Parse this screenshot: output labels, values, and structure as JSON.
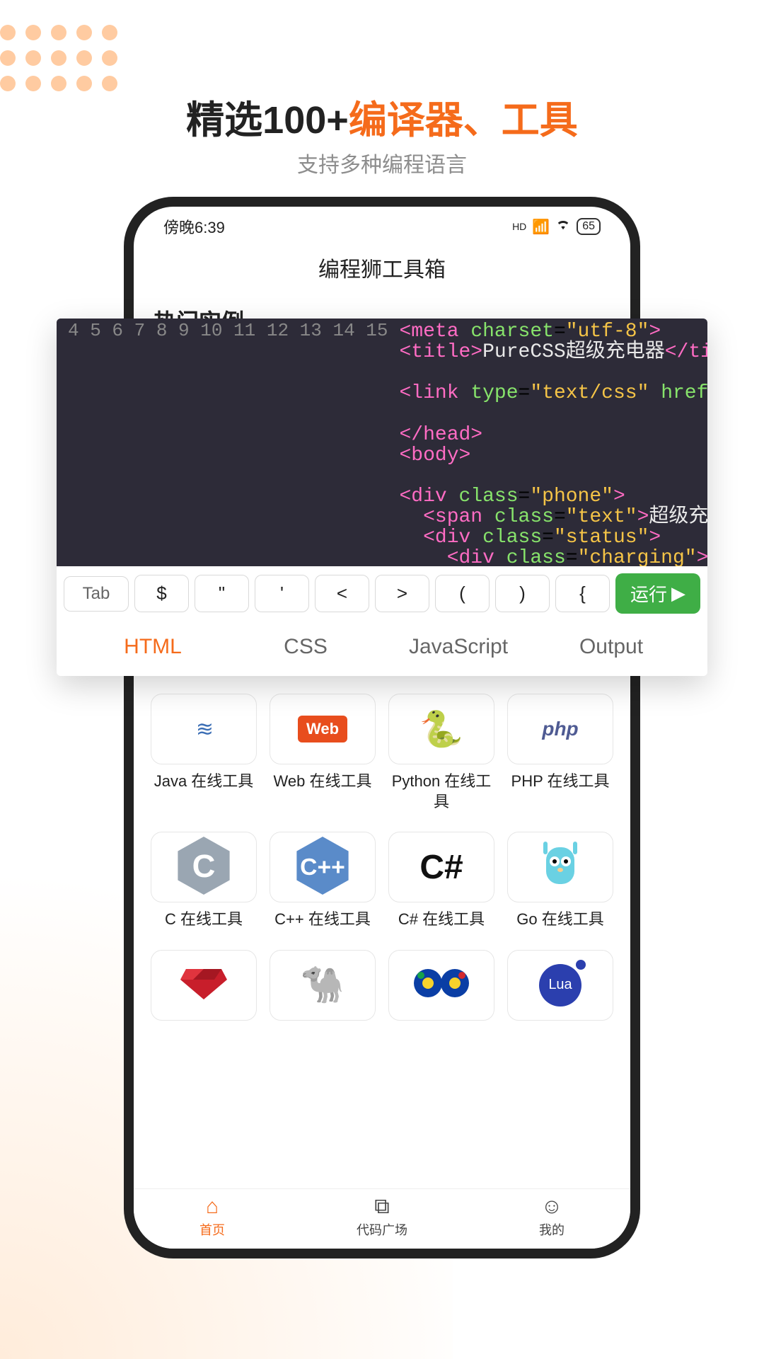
{
  "headline": {
    "pre": "精选100+",
    "accent": "编译器、工具"
  },
  "subhead": "支持多种编程语言",
  "phone": {
    "status_time": "傍晚6:39",
    "status_net": "HD",
    "battery": "65",
    "title": "编程狮工具箱",
    "section": "热门实例",
    "nav": {
      "home": "首页",
      "plaza": "代码广场",
      "me": "我的"
    },
    "tools_row1": [
      {
        "label": "Java 在线工具",
        "icon": "java"
      },
      {
        "label": "Web 在线工具",
        "icon": "web"
      },
      {
        "label": "Python 在线工具",
        "icon": "python"
      },
      {
        "label": "PHP 在线工具",
        "icon": "php"
      }
    ],
    "tools_row2": [
      {
        "label": "C 在线工具",
        "icon": "c"
      },
      {
        "label": "C++ 在线工具",
        "icon": "cpp"
      },
      {
        "label": "C# 在线工具",
        "icon": "csh"
      },
      {
        "label": "Go 在线工具",
        "icon": "go"
      }
    ],
    "tools_row3": [
      {
        "icon": "ruby"
      },
      {
        "icon": "perl"
      },
      {
        "icon": "raku"
      },
      {
        "icon": "lua"
      }
    ]
  },
  "editor": {
    "gutter": [
      "4",
      "5",
      "6",
      "7",
      "8",
      "9",
      "10",
      "11",
      "12",
      "13",
      "14",
      "15"
    ],
    "code_lines": [
      {
        "html": "<span class='tg'>&lt;meta</span> <span class='at'>charset</span>=<span class='st'>\"utf-8\"</span><span class='tg'>&gt;</span>"
      },
      {
        "html": "<span class='tg'>&lt;title&gt;</span><span class='tx'>PureCSS超级充电器</span><span class='tg'>&lt;/title&gt;</span>"
      },
      {
        "html": ""
      },
      {
        "html": "<span class='tg'>&lt;link</span> <span class='at'>type</span>=<span class='st'>\"text/css\"</span> <span class='at'>href</span>=<span class='st'>\"css/style.cs</span>"
      },
      {
        "html": ""
      },
      {
        "html": "<span class='tg'>&lt;/head&gt;</span>"
      },
      {
        "html": "<span class='tg'>&lt;body&gt;</span>"
      },
      {
        "html": ""
      },
      {
        "html": "<span class='tg'>&lt;div</span> <span class='at'>class</span>=<span class='st'>\"phone\"</span><span class='tg'>&gt;</span>"
      },
      {
        "html": "  <span class='tg'>&lt;span</span> <span class='at'>class</span>=<span class='st'>\"text\"</span><span class='tg'>&gt;</span><span class='tx'>超级充电</span><span class='tg'>&lt;/span&gt;</span>"
      },
      {
        "html": "  <span class='tg'>&lt;div</span> <span class='at'>class</span>=<span class='st'>\"status\"</span><span class='tg'>&gt;</span>"
      },
      {
        "html": "    <span class='tg'>&lt;div</span> <span class='at'>class</span>=<span class='st'>\"charging\"</span><span class='tg'>&gt;&lt;/div&gt;</span>"
      }
    ],
    "keys": [
      "Tab",
      "$",
      "\"",
      "'",
      "<",
      ">",
      "(",
      ")",
      "{"
    ],
    "run_label": "运行",
    "tabs": [
      "HTML",
      "CSS",
      "JavaScript",
      "Output"
    ]
  }
}
